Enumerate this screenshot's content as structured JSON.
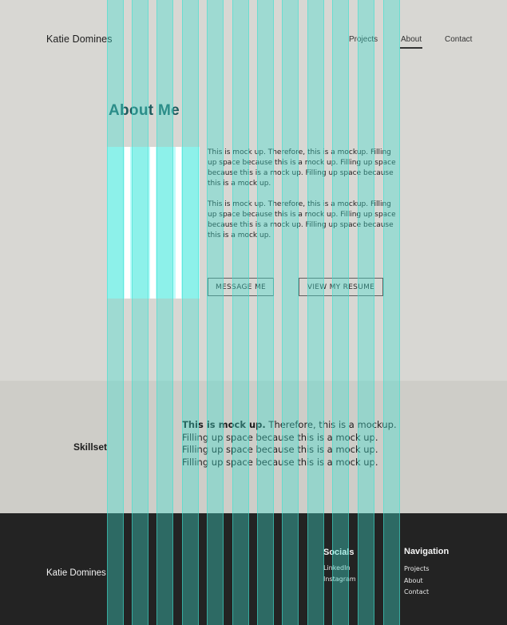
{
  "header": {
    "brand": "Katie Domines",
    "nav": {
      "projects": "Projects",
      "about": "About",
      "contact": "Contact"
    },
    "active_nav": "About"
  },
  "about": {
    "title": "About Me",
    "paragraph1": "This is mock up. Therefore, this is a mockup. Filling up space because this is a mock up. Filling up space because this is a mock up. Filling up space because this is a mock up.",
    "paragraph2": "This is mock up. Therefore, this is a mockup. Filling up space because this is a mock up. Filling up space because this is a mock up. Filling up space because this is a mock up.",
    "buttons": {
      "message": "MESSAGE ME",
      "resume": "VIEW MY RESUME"
    }
  },
  "skillset": {
    "label": "Skillset",
    "lead": "This is mock up.",
    "text": " Therefore, this is a mockup. Filling up space because this is a mock up. Filling up space because this is a mock up. Filling up space because this is a mock up."
  },
  "footer": {
    "brand": "Katie Domines",
    "socials": {
      "heading": "Socials",
      "links": [
        "LinkedIn",
        "Instagram"
      ]
    },
    "navigation": {
      "heading": "Navigation",
      "links": [
        "Projects",
        "About",
        "Contact"
      ]
    }
  },
  "colors": {
    "accent_title": "#1f5b5e",
    "hero_bg": "#d8d7d3",
    "skill_bg": "#cecdc8",
    "footer_bg": "#232323",
    "grid_overlay": "#40e0d0",
    "photo_placeholder": "#bdfcfb"
  }
}
